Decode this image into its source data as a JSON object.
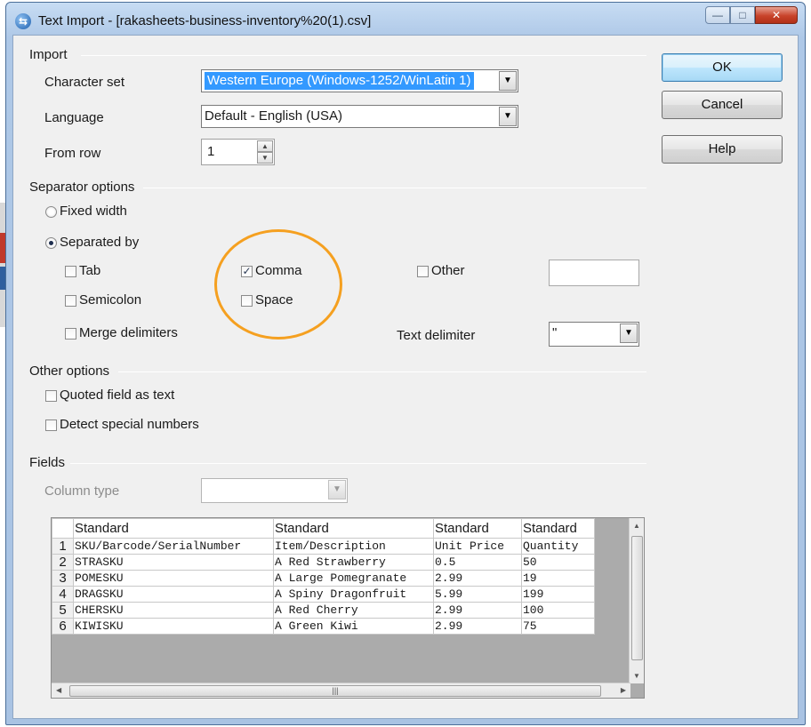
{
  "window": {
    "title": "Text Import - [rakasheets-business-inventory%20(1).csv]",
    "minimize_glyph": "—",
    "maximize_glyph": "□",
    "close_glyph": "✕"
  },
  "buttons": {
    "ok": "OK",
    "cancel": "Cancel",
    "help": "Help"
  },
  "import": {
    "section": "Import",
    "charset_label": "Character set",
    "charset_value": "Western Europe (Windows-1252/WinLatin 1)",
    "language_label": "Language",
    "language_value": "Default - English (USA)",
    "fromrow_label": "From row",
    "fromrow_value": "1"
  },
  "separator": {
    "section": "Separator options",
    "fixed_width": "Fixed width",
    "separated_by": "Separated by",
    "tab": "Tab",
    "comma": "Comma",
    "other": "Other",
    "semicolon": "Semicolon",
    "space": "Space",
    "merge": "Merge delimiters",
    "text_delim_label": "Text delimiter",
    "text_delim_value": "\"",
    "selected_mode": "Separated by",
    "checked": [
      "Comma"
    ]
  },
  "other_options": {
    "section": "Other options",
    "quoted": "Quoted field as text",
    "detect": "Detect special numbers"
  },
  "fields": {
    "section": "Fields",
    "column_type_label": "Column type",
    "column_headers": [
      "Standard",
      "Standard",
      "Standard",
      "Standard"
    ],
    "rows": [
      {
        "n": "1",
        "cells": [
          "SKU/Barcode/SerialNumber",
          "Item/Description",
          "Unit Price",
          "Quantity"
        ]
      },
      {
        "n": "2",
        "cells": [
          "STRASKU",
          "A Red Strawberry",
          "0.5",
          "50"
        ]
      },
      {
        "n": "3",
        "cells": [
          "POMESKU",
          "A Large Pomegranate",
          "2.99",
          "19"
        ]
      },
      {
        "n": "4",
        "cells": [
          "DRAGSKU",
          "A Spiny Dragonfruit",
          "5.99",
          "199"
        ]
      },
      {
        "n": "5",
        "cells": [
          "CHERSKU",
          "A Red Cherry",
          "2.99",
          "100"
        ]
      },
      {
        "n": "6",
        "cells": [
          "KIWISKU",
          "A Green Kiwi",
          "2.99",
          "75"
        ]
      }
    ]
  },
  "colors": {
    "highlight_ellipse": "#f5a020",
    "selection": "#3399ff"
  }
}
